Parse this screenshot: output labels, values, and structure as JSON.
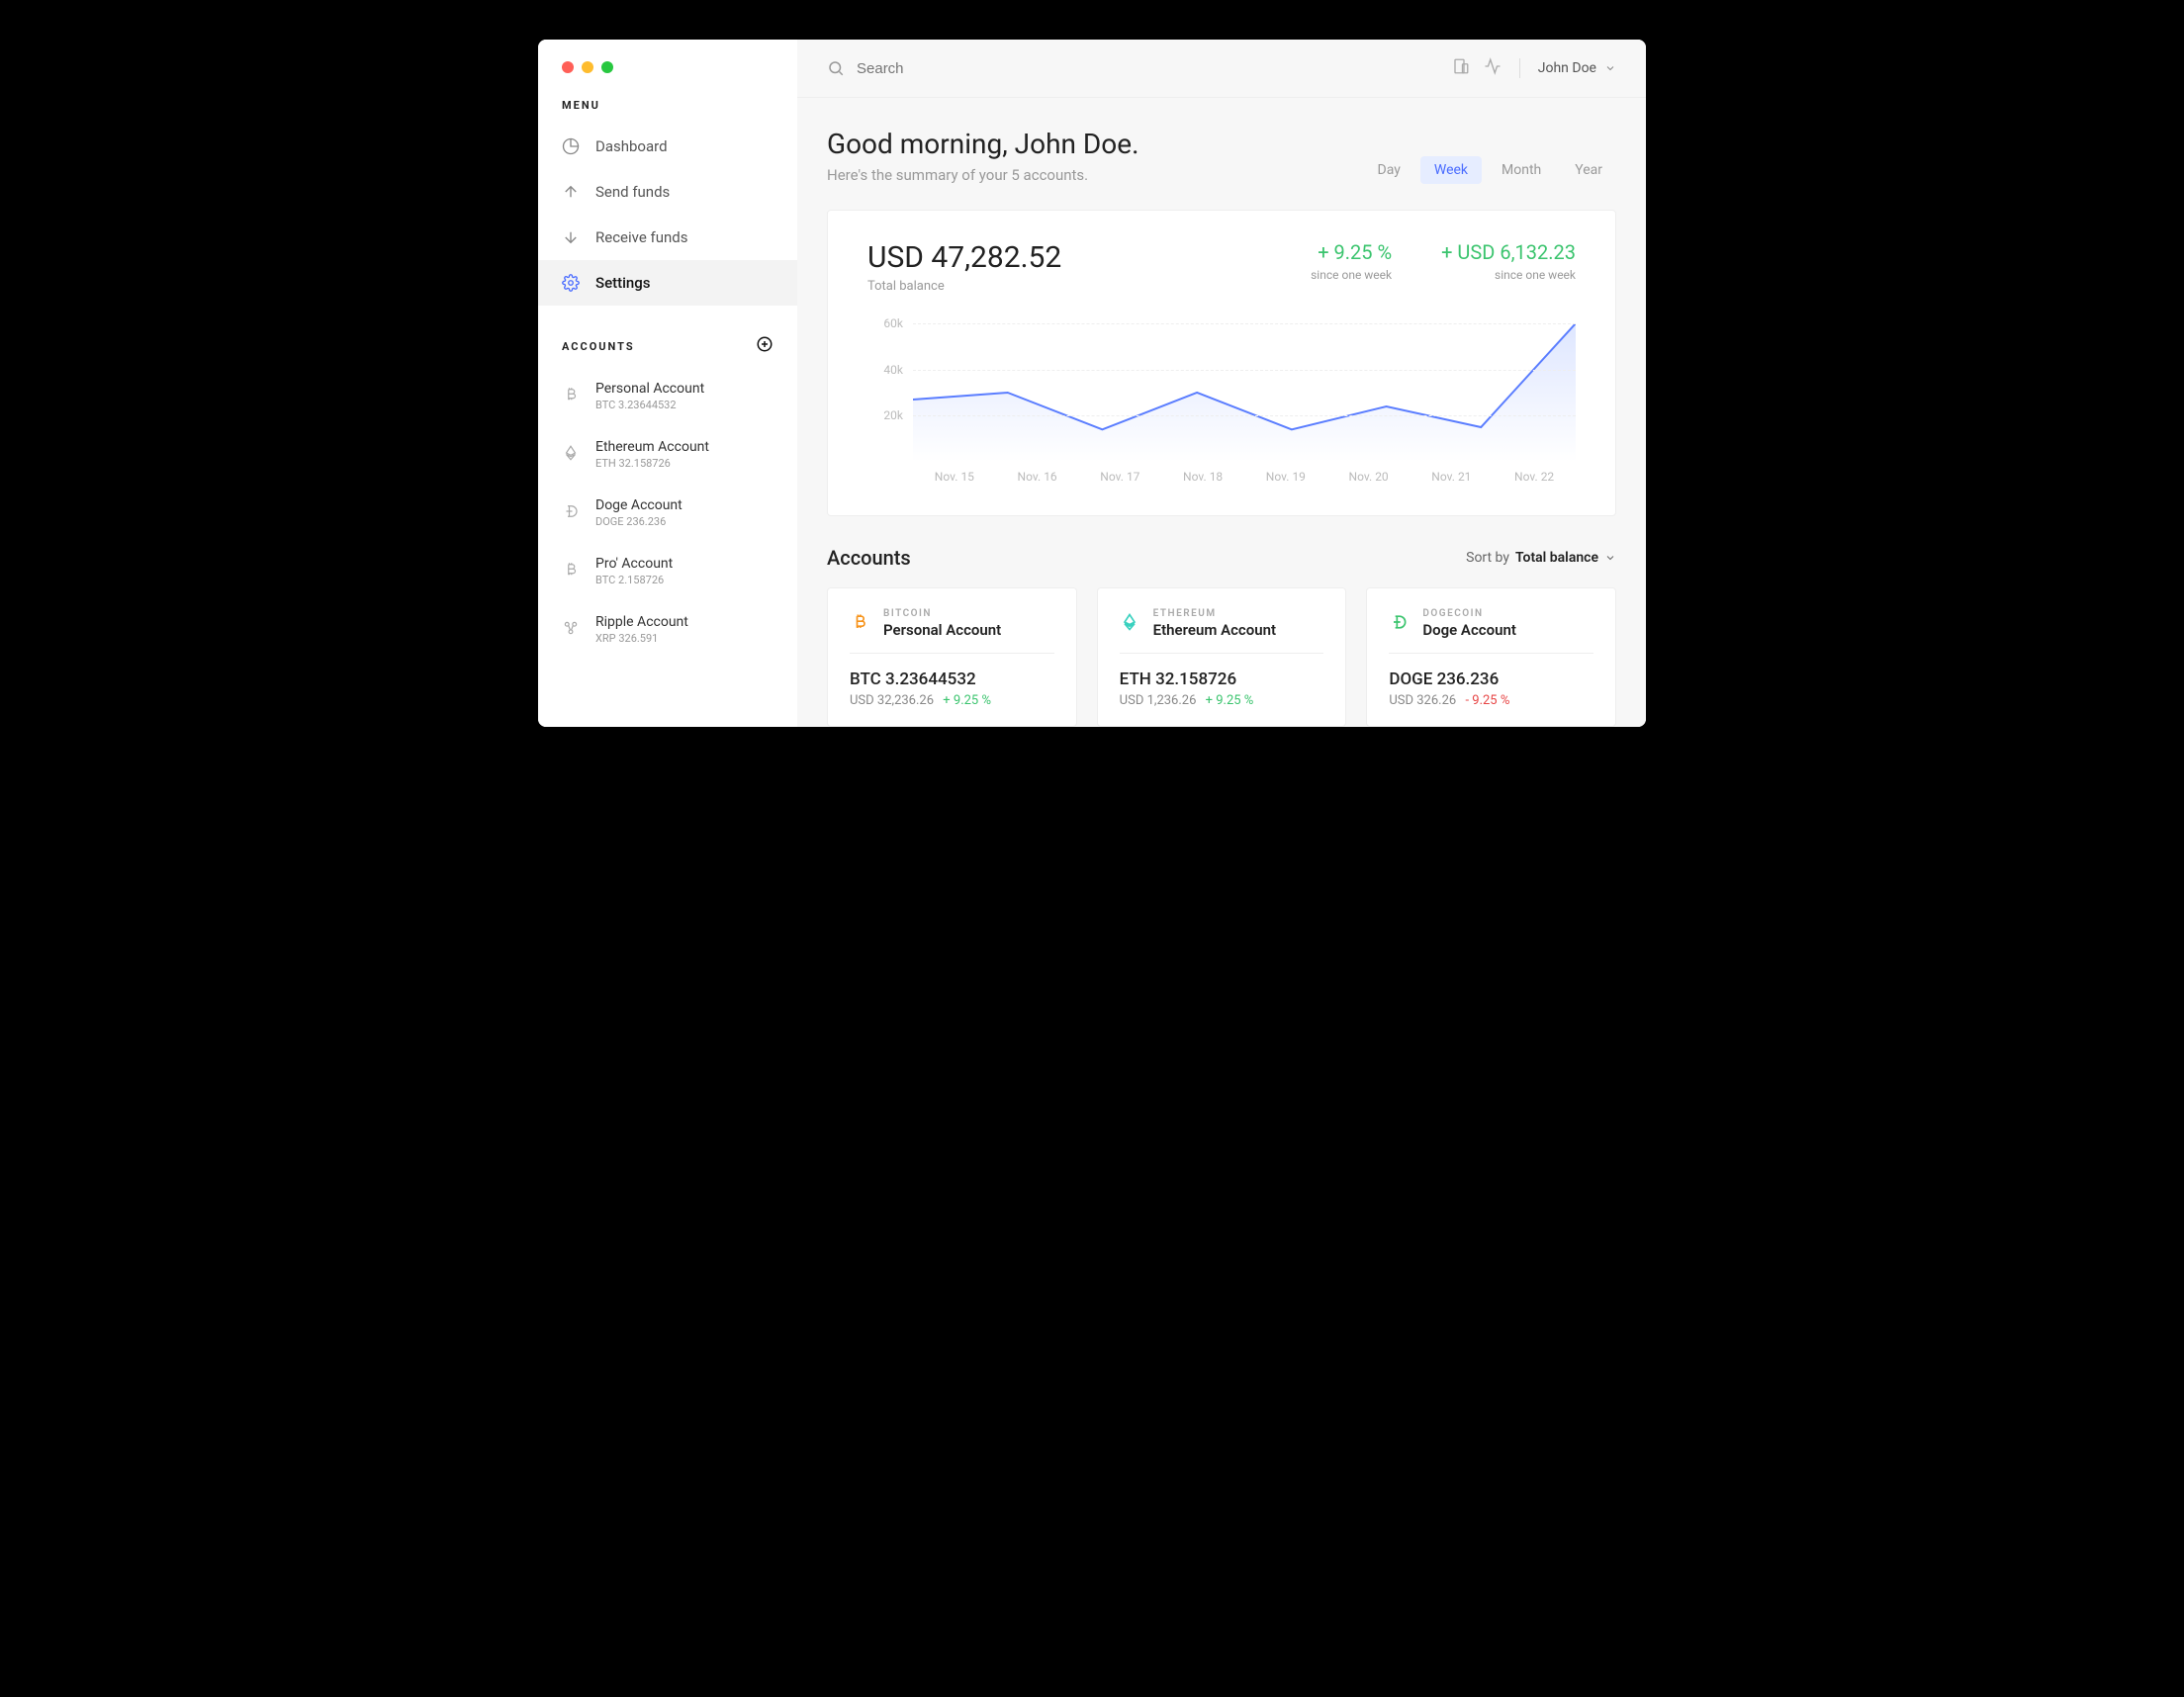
{
  "sidebar": {
    "menu_label": "MENU",
    "items": [
      {
        "label": "Dashboard"
      },
      {
        "label": "Send funds"
      },
      {
        "label": "Receive funds"
      },
      {
        "label": "Settings"
      }
    ],
    "accounts_label": "ACCOUNTS",
    "accounts": [
      {
        "name": "Personal Account",
        "sub": "BTC 3.23644532"
      },
      {
        "name": "Ethereum Account",
        "sub": "ETH 32.158726"
      },
      {
        "name": "Doge Account",
        "sub": "DOGE 236.236"
      },
      {
        "name": "Pro' Account",
        "sub": "BTC 2.158726"
      },
      {
        "name": "Ripple Account",
        "sub": "XRP 326.591"
      }
    ]
  },
  "topbar": {
    "search_placeholder": "Search",
    "user_name": "John Doe"
  },
  "greeting": {
    "title": "Good morning, John Doe.",
    "subtitle": "Here's the summary of your 5 accounts."
  },
  "period_tabs": {
    "items": [
      "Day",
      "Week",
      "Month",
      "Year"
    ],
    "active": "Week"
  },
  "balance": {
    "amount": "USD 47,282.52",
    "amount_label": "Total balance",
    "pct_change": "+ 9.25 %",
    "pct_change_label": "since one week",
    "usd_change": "+ USD 6,132.23",
    "usd_change_label": "since one week"
  },
  "chart_data": {
    "type": "line",
    "categories": [
      "Nov. 15",
      "Nov. 16",
      "Nov. 17",
      "Nov. 18",
      "Nov. 19",
      "Nov. 20",
      "Nov. 21",
      "Nov. 22"
    ],
    "values": [
      27000,
      30000,
      14000,
      30000,
      14000,
      24000,
      15000,
      60000
    ],
    "ylabel": "",
    "xlabel": "",
    "ylim": [
      0,
      60000
    ],
    "y_ticks": [
      "60k",
      "40k",
      "20k"
    ]
  },
  "accounts_section": {
    "title": "Accounts",
    "sort_label": "Sort by",
    "sort_value": "Total balance",
    "cards": [
      {
        "coin_label": "BITCOIN",
        "name": "Personal Account",
        "balance": "BTC 3.23644532",
        "usd": "USD 32,236.26",
        "change": "+ 9.25 %",
        "change_sign": "pos",
        "color": "#f7931a"
      },
      {
        "coin_label": "ETHEREUM",
        "name": "Ethereum Account",
        "balance": "ETH 32.158726",
        "usd": "USD 1,236.26",
        "change": "+ 9.25 %",
        "change_sign": "pos",
        "color": "#3ad1bf"
      },
      {
        "coin_label": "DOGECOIN",
        "name": "Doge Account",
        "balance": "DOGE 236.236",
        "usd": "USD 326.26",
        "change": "- 9.25 %",
        "change_sign": "neg",
        "color": "#3bc46e"
      }
    ]
  }
}
